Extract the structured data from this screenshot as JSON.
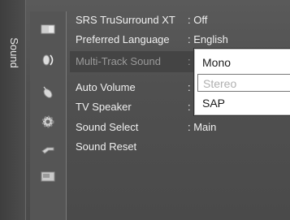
{
  "sidebar": {
    "label": "Sound"
  },
  "menu": {
    "items": [
      {
        "label": "SRS TruSurround XT",
        "value": ": Off",
        "dimmed": false
      },
      {
        "label": "Preferred Language",
        "value": ": English",
        "dimmed": false
      },
      {
        "label": "Multi-Track Sound",
        "value": ":",
        "dimmed": true
      },
      {
        "label": "Auto Volume",
        "value": ":",
        "dimmed": false
      },
      {
        "label": "TV Speaker",
        "value": ":",
        "dimmed": false
      },
      {
        "label": "Sound Select",
        "value": ": Main",
        "dimmed": false
      },
      {
        "label": "Sound Reset",
        "value": "",
        "dimmed": false
      }
    ]
  },
  "dropdown": {
    "options": [
      "Mono",
      "Stereo",
      "SAP"
    ]
  },
  "icons": [
    "picture-icon",
    "sound-icon",
    "channel-icon",
    "setup-icon",
    "input-icon",
    "application-icon"
  ]
}
